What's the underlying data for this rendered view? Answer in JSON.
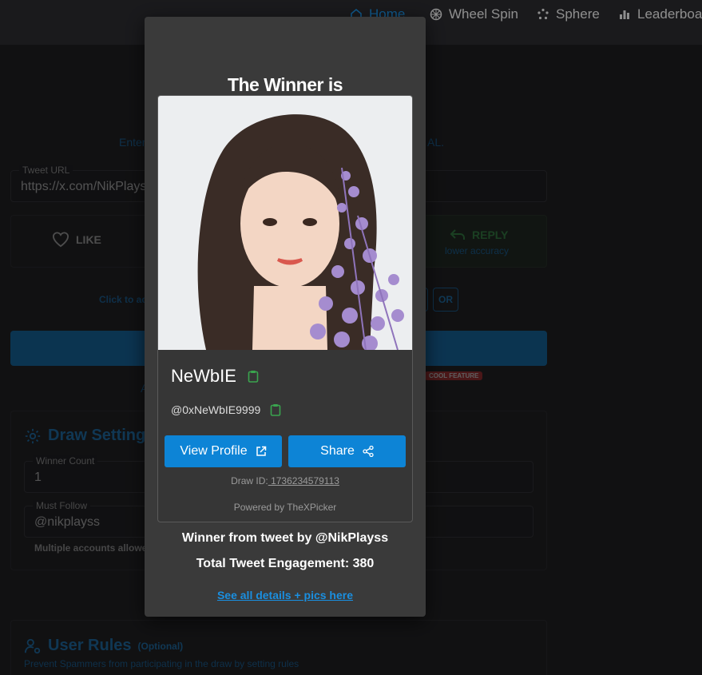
{
  "nav": {
    "home": "Home",
    "wheel_spin": "Wheel Spin",
    "sphere": "Sphere",
    "leaderboard": "Leaderboa"
  },
  "background": {
    "subtitle_left": "Enter",
    "subtitle_right": "AL.",
    "tweet_url_label": "Tweet URL",
    "tweet_url_value": "https://x.com/NikPlays",
    "like_label": "LIKE",
    "reply_label": "REPLY",
    "reply_sub": "lower accuracy",
    "click_to": "Click to ac",
    "or_label": "OR",
    "cool_feature": "COOL FEATURE",
    "a_fragment": "A",
    "draw_settings_title": "Draw Setting",
    "winner_count_label": "Winner Count",
    "winner_count_value": "1",
    "must_follow_label": "Must Follow",
    "must_follow_value": "@nikplayss",
    "multiple_accounts": "Multiple accounts allowe",
    "user_rules_title": "User Rules",
    "user_rules_optional": "(Optional)",
    "user_rules_sub": "Prevent Spammers from participating in the draw by setting rules"
  },
  "modal": {
    "title": "The Winner is",
    "winner_name": "NeWbIE",
    "winner_handle": "@0xNeWbIE9999",
    "view_profile": "View Profile",
    "share": "Share",
    "draw_id_label": "Draw ID:",
    "draw_id_value": " 1736234579113",
    "powered_by": "Powered by TheXPicker",
    "winner_from": "Winner from tweet by @NikPlayss",
    "engagement": "Total Tweet Engagement: 380",
    "details_link": "See all details + pics here"
  },
  "colors": {
    "accent": "#0d84d6",
    "copy_icon": "#3aa44e",
    "badge": "#c53030"
  }
}
